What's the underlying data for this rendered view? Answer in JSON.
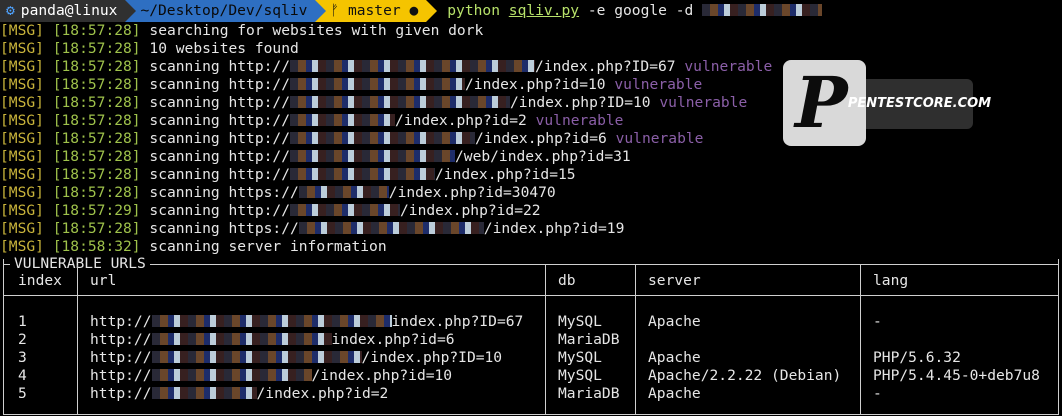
{
  "prompt": {
    "gear_icon": "⚙",
    "user_host": "panda@linux",
    "path": "~/Desktop/Dev/sqliv",
    "branch_icon": "ᚠ",
    "branch": "master",
    "dirty_dot": "●",
    "cmd_python": "python",
    "cmd_script": "sqliv.py",
    "cmd_args": "-e google -d"
  },
  "log": [
    {
      "tag": "[MSG]",
      "time": "[18:57:28]",
      "text": "searching for websites with given dork",
      "url_pre": "",
      "url_post": "",
      "status": ""
    },
    {
      "tag": "[MSG]",
      "time": "[18:57:28]",
      "text": "10 websites found",
      "url_pre": "",
      "url_post": "",
      "status": ""
    },
    {
      "tag": "[MSG]",
      "time": "[18:57:28]",
      "text": "scanning ",
      "url_pre": "http://",
      "url_post": "/index.php?ID=67",
      "status": "vulnerable"
    },
    {
      "tag": "[MSG]",
      "time": "[18:57:28]",
      "text": "scanning ",
      "url_pre": "http://",
      "url_post": "/index.php?id=10",
      "status": "vulnerable"
    },
    {
      "tag": "[MSG]",
      "time": "[18:57:28]",
      "text": "scanning ",
      "url_pre": "http://",
      "url_post": "/index.php?ID=10",
      "status": "vulnerable"
    },
    {
      "tag": "[MSG]",
      "time": "[18:57:28]",
      "text": "scanning ",
      "url_pre": "http://",
      "url_post": "/index.php?id=2",
      "status": "vulnerable"
    },
    {
      "tag": "[MSG]",
      "time": "[18:57:28]",
      "text": "scanning ",
      "url_pre": "http://",
      "url_post": "/index.php?id=6",
      "status": "vulnerable"
    },
    {
      "tag": "[MSG]",
      "time": "[18:57:28]",
      "text": "scanning ",
      "url_pre": "http://",
      "url_post": "/web/index.php?id=31",
      "status": ""
    },
    {
      "tag": "[MSG]",
      "time": "[18:57:28]",
      "text": "scanning ",
      "url_pre": "http://",
      "url_post": "/index.php?id=15",
      "status": ""
    },
    {
      "tag": "[MSG]",
      "time": "[18:57:28]",
      "text": "scanning ",
      "url_pre": "https://",
      "url_post": "/index.php?id=30470",
      "status": ""
    },
    {
      "tag": "[MSG]",
      "time": "[18:57:29]",
      "text": "scanning ",
      "url_pre": "http://",
      "url_post": "/index.php?id=22",
      "status": ""
    },
    {
      "tag": "[MSG]",
      "time": "[18:57:28]",
      "text": "scanning ",
      "url_pre": "https://",
      "url_post": "/index.php?id=19",
      "status": ""
    },
    {
      "tag": "[MSG]",
      "time": "[18:58:32]",
      "text": "scanning server information",
      "url_pre": "",
      "url_post": "",
      "status": ""
    }
  ],
  "logo": {
    "letter": "P",
    "label": "PENTESTCORE.COM"
  },
  "table": {
    "title": "VULNERABLE URLS",
    "headers": [
      "index",
      "url",
      "db",
      "server",
      "lang"
    ],
    "rows": [
      {
        "index": "1",
        "url_pre": "http://",
        "url_post": "index.php?ID=67",
        "db": "MySQL",
        "server": "Apache",
        "lang": "-"
      },
      {
        "index": "2",
        "url_pre": "http://",
        "url_post": "index.php?id=6",
        "db": "MariaDB",
        "server": "",
        "lang": ""
      },
      {
        "index": "3",
        "url_pre": "http://",
        "url_post": "/index.php?ID=10",
        "db": "MySQL",
        "server": "Apache",
        "lang": "PHP/5.6.32"
      },
      {
        "index": "4",
        "url_pre": "http://",
        "url_post": "/index.php?id=10",
        "db": "MySQL",
        "server": "Apache/2.2.22 (Debian)",
        "lang": "PHP/5.4.45-0+deb7u8"
      },
      {
        "index": "5",
        "url_pre": "http://",
        "url_post": "/index.php?id=2",
        "db": "MariaDB",
        "server": "Apache",
        "lang": "-"
      }
    ]
  }
}
